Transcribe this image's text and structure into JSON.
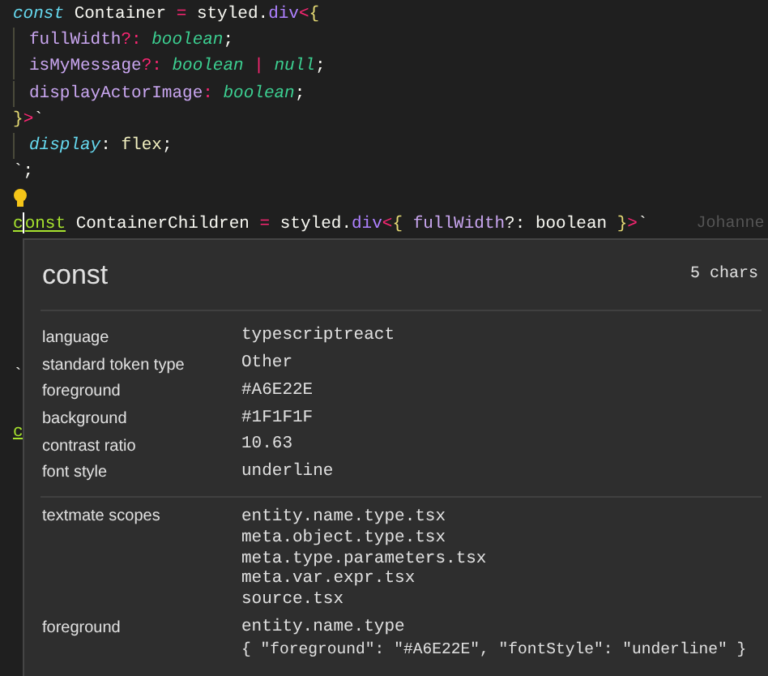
{
  "editor": {
    "lines": [
      {
        "kind": "code",
        "tokens": [
          {
            "text": "const",
            "kind": "keyword"
          },
          {
            "text": " Container ",
            "kind": "ident"
          },
          {
            "text": "=",
            "kind": "operator"
          },
          {
            "text": " styled",
            "kind": "ident"
          },
          {
            "text": ".",
            "kind": "plain"
          },
          {
            "text": "div",
            "kind": "member"
          },
          {
            "text": "<",
            "kind": "operator"
          },
          {
            "text": "{",
            "kind": "bracket"
          }
        ]
      },
      {
        "kind": "code",
        "indent": true,
        "tokens": [
          {
            "text": "fullWidth",
            "kind": "prop"
          },
          {
            "text": "?:",
            "kind": "operator"
          },
          {
            "text": " boolean",
            "kind": "type"
          },
          {
            "text": ";",
            "kind": "plain"
          }
        ]
      },
      {
        "kind": "code",
        "indent": true,
        "tokens": [
          {
            "text": "isMyMessage",
            "kind": "prop"
          },
          {
            "text": "?:",
            "kind": "operator"
          },
          {
            "text": " boolean",
            "kind": "type"
          },
          {
            "text": " |",
            "kind": "operator"
          },
          {
            "text": " null",
            "kind": "type"
          },
          {
            "text": ";",
            "kind": "plain"
          }
        ]
      },
      {
        "kind": "code",
        "indent": true,
        "tokens": [
          {
            "text": "displayActorImage",
            "kind": "prop"
          },
          {
            "text": ":",
            "kind": "operator"
          },
          {
            "text": " boolean",
            "kind": "type"
          },
          {
            "text": ";",
            "kind": "plain"
          }
        ]
      },
      {
        "kind": "code",
        "tokens": [
          {
            "text": "}",
            "kind": "bracket"
          },
          {
            "text": ">",
            "kind": "operator"
          },
          {
            "text": "`",
            "kind": "plain"
          }
        ]
      },
      {
        "kind": "code",
        "indent": true,
        "tokens": [
          {
            "text": "display",
            "kind": "css-prop"
          },
          {
            "text": ":",
            "kind": "plain"
          },
          {
            "text": " flex",
            "kind": "css-value"
          },
          {
            "text": ";",
            "kind": "plain"
          }
        ]
      },
      {
        "kind": "code",
        "tokens": [
          {
            "text": "`;",
            "kind": "plain"
          }
        ]
      },
      {
        "kind": "lightbulb"
      },
      {
        "kind": "code",
        "blame": "Johanne",
        "tokens": [
          {
            "text": "c",
            "kind": "keyword-hover",
            "cursor_after": true
          },
          {
            "text": "onst",
            "kind": "keyword-hover"
          },
          {
            "text": " ContainerChildren ",
            "kind": "ident"
          },
          {
            "text": "=",
            "kind": "operator"
          },
          {
            "text": " styled",
            "kind": "ident"
          },
          {
            "text": ".",
            "kind": "plain"
          },
          {
            "text": "div",
            "kind": "member"
          },
          {
            "text": "<",
            "kind": "operator"
          },
          {
            "text": "{",
            "kind": "bracket"
          },
          {
            "text": " fullWidth",
            "kind": "prop"
          },
          {
            "text": "?: boolean ",
            "kind": "ident"
          },
          {
            "text": "}",
            "kind": "bracket"
          },
          {
            "text": ">",
            "kind": "operator"
          },
          {
            "text": "`",
            "kind": "plain"
          }
        ]
      }
    ],
    "obscured_fragments": [
      {
        "text": "`",
        "kind": "plain"
      },
      {
        "text": "c",
        "kind": "keyword-hover"
      }
    ]
  },
  "inspector": {
    "token": "const",
    "length": "5 chars",
    "properties": [
      {
        "label": "language",
        "value": "typescriptreact"
      },
      {
        "label": "standard token type",
        "value": "Other"
      },
      {
        "label": "foreground",
        "value": "#A6E22E"
      },
      {
        "label": "background",
        "value": "#1F1F1F"
      },
      {
        "label": "contrast ratio",
        "value": "10.63"
      },
      {
        "label": "font style",
        "value": "underline"
      }
    ],
    "textmate_scopes": {
      "label": "textmate scopes",
      "values": [
        "entity.name.type.tsx",
        "meta.object.type.tsx",
        "meta.type.parameters.tsx",
        "meta.var.expr.tsx",
        "source.tsx"
      ]
    },
    "theme_rule": {
      "label": "foreground",
      "selector": "entity.name.type",
      "rule": "{ \"foreground\": \"#A6E22E\", \"fontStyle\": \"underline\" }"
    }
  }
}
